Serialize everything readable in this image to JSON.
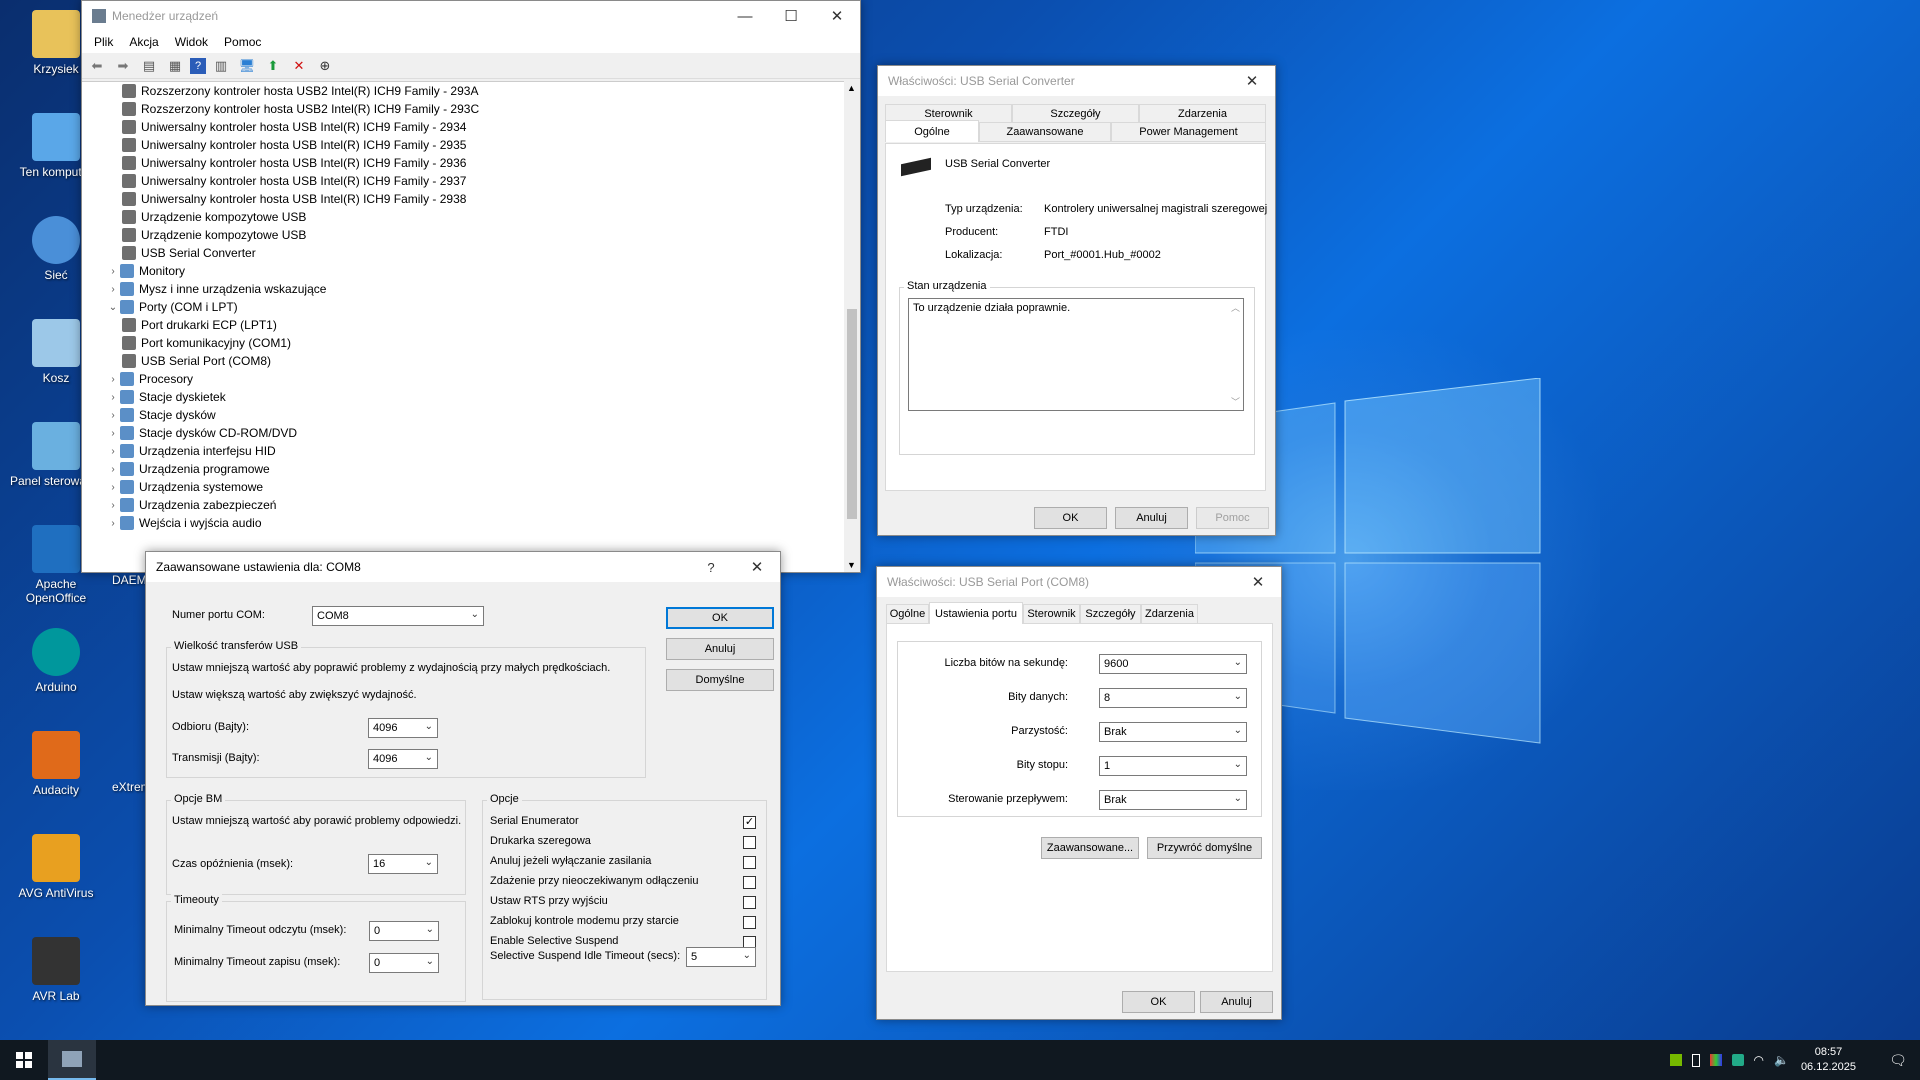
{
  "desktop": {
    "icons": [
      {
        "label": "Krzysiek",
        "icon": "user-folder-icon"
      },
      {
        "label": "Ten komputer",
        "icon": "computer-icon"
      },
      {
        "label": "Sieć",
        "icon": "network-icon"
      },
      {
        "label": "Kosz",
        "icon": "recycle-bin-icon"
      },
      {
        "label": "Panel sterowania",
        "icon": "control-panel-icon"
      },
      {
        "label": "Apache OpenOffice",
        "icon": "openoffice-icon"
      },
      {
        "label": "Arduino",
        "icon": "arduino-icon"
      },
      {
        "label": "Audacity",
        "icon": "audacity-icon"
      },
      {
        "label": "AVG AntiVirus",
        "icon": "avg-icon"
      },
      {
        "label": "AVR Lab",
        "icon": "avr-lab-icon"
      }
    ],
    "partial_labels": [
      "DAEM",
      "eXtrem"
    ]
  },
  "device_manager": {
    "title": "Menedżer urządzeń",
    "menu": [
      "Plik",
      "Akcja",
      "Widok",
      "Pomoc"
    ],
    "tree": [
      {
        "label": "Rozszerzony kontroler hosta USB2 Intel(R) ICH9 Family - 293A",
        "level": 2
      },
      {
        "label": "Rozszerzony kontroler hosta USB2 Intel(R) ICH9 Family - 293C",
        "level": 2
      },
      {
        "label": "Uniwersalny kontroler hosta USB Intel(R) ICH9 Family - 2934",
        "level": 2
      },
      {
        "label": "Uniwersalny kontroler hosta USB Intel(R) ICH9 Family - 2935",
        "level": 2
      },
      {
        "label": "Uniwersalny kontroler hosta USB Intel(R) ICH9 Family - 2936",
        "level": 2
      },
      {
        "label": "Uniwersalny kontroler hosta USB Intel(R) ICH9 Family - 2937",
        "level": 2
      },
      {
        "label": "Uniwersalny kontroler hosta USB Intel(R) ICH9 Family - 2938",
        "level": 2
      },
      {
        "label": "Urządzenie kompozytowe USB",
        "level": 2
      },
      {
        "label": "Urządzenie kompozytowe USB",
        "level": 2
      },
      {
        "label": "USB Serial Converter",
        "level": 2
      },
      {
        "label": "Monitory",
        "level": 1,
        "expander": "›"
      },
      {
        "label": "Mysz i inne urządzenia wskazujące",
        "level": 1,
        "expander": "›"
      },
      {
        "label": "Porty (COM i LPT)",
        "level": 1,
        "expander": "⌄"
      },
      {
        "label": "Port drukarki ECP (LPT1)",
        "level": 2
      },
      {
        "label": "Port komunikacyjny (COM1)",
        "level": 2
      },
      {
        "label": "USB Serial Port (COM8)",
        "level": 2
      },
      {
        "label": "Procesory",
        "level": 1,
        "expander": "›"
      },
      {
        "label": "Stacje dyskietek",
        "level": 1,
        "expander": "›"
      },
      {
        "label": "Stacje dysków",
        "level": 1,
        "expander": "›"
      },
      {
        "label": "Stacje dysków CD-ROM/DVD",
        "level": 1,
        "expander": "›"
      },
      {
        "label": "Urządzenia interfejsu HID",
        "level": 1,
        "expander": "›"
      },
      {
        "label": "Urządzenia programowe",
        "level": 1,
        "expander": "›"
      },
      {
        "label": "Urządzenia systemowe",
        "level": 1,
        "expander": "›"
      },
      {
        "label": "Urządzenia zabezpieczeń",
        "level": 1,
        "expander": "›"
      },
      {
        "label": "Wejścia i wyjścia audio",
        "level": 1,
        "expander": "›"
      }
    ]
  },
  "converter_props": {
    "title": "Właściwości: USB Serial Converter",
    "tabs_row1": [
      "Sterownik",
      "Szczegóły",
      "Zdarzenia"
    ],
    "tabs_row2": [
      "Ogólne",
      "Zaawansowane",
      "Power Management"
    ],
    "device_name": "USB Serial Converter",
    "type_label": "Typ urządzenia:",
    "type_value": "Kontrolery uniwersalnej magistrali szeregowej",
    "maker_label": "Producent:",
    "maker_value": "FTDI",
    "loc_label": "Lokalizacja:",
    "loc_value": "Port_#0001.Hub_#0002",
    "status_group": "Stan urządzenia",
    "status_text": "To urządzenie działa poprawnie.",
    "ok": "OK",
    "cancel": "Anuluj",
    "help": "Pomoc"
  },
  "port_props": {
    "title": "Właściwości: USB Serial Port (COM8)",
    "tabs": [
      "Ogólne",
      "Ustawienia portu",
      "Sterownik",
      "Szczegóły",
      "Zdarzenia"
    ],
    "bits_label": "Liczba bitów na sekundę:",
    "bits_value": "9600",
    "data_label": "Bity danych:",
    "data_value": "8",
    "parity_label": "Parzystość:",
    "parity_value": "Brak",
    "stop_label": "Bity stopu:",
    "stop_value": "1",
    "flow_label": "Sterowanie przepływem:",
    "flow_value": "Brak",
    "advanced": "Zaawansowane...",
    "restore": "Przywróć domyślne",
    "ok": "OK",
    "cancel": "Anuluj"
  },
  "advanced": {
    "title": "Zaawansowane ustawienia dla: COM8",
    "help_glyph": "?",
    "com_label": "Numer portu COM:",
    "com_value": "COM8",
    "usb_group": "Wielkość transferów USB",
    "usb_hint1": "Ustaw mniejszą wartość aby poprawić problemy z wydajnością przy małych prędkościach.",
    "usb_hint2": "Ustaw większą wartość aby zwiększyć wydajność.",
    "rx_label": "Odbioru (Bajty):",
    "rx_value": "4096",
    "tx_label": "Transmisji (Bajty):",
    "tx_value": "4096",
    "bm_group": "Opcje BM",
    "bm_hint": "Ustaw mniejszą wartość aby porawić problemy odpowiedzi.",
    "latency_label": "Czas opóźnienia (msek):",
    "latency_value": "16",
    "timeouts_group": "Timeouty",
    "read_timeout_label": "Minimalny Timeout odczytu (msek):",
    "read_timeout_value": "0",
    "write_timeout_label": "Minimalny Timeout zapisu (msek):",
    "write_timeout_value": "0",
    "options_group": "Opcje",
    "options": [
      {
        "label": "Serial Enumerator",
        "checked": true
      },
      {
        "label": "Drukarka szeregowa",
        "checked": false
      },
      {
        "label": "Anuluj jeżeli wyłączanie zasilania",
        "checked": false
      },
      {
        "label": "Zdażenie przy nieoczekiwanym odłączeniu",
        "checked": false
      },
      {
        "label": "Ustaw RTS przy wyjściu",
        "checked": false
      },
      {
        "label": "Zablokuj kontrole modemu przy starcie",
        "checked": false
      },
      {
        "label": "Enable Selective Suspend",
        "checked": false
      }
    ],
    "suspend_label": "Selective Suspend Idle Timeout (secs):",
    "suspend_value": "5",
    "ok": "OK",
    "cancel": "Anuluj",
    "defaults": "Domyślne"
  },
  "taskbar": {
    "time": "08:57",
    "date": "06.12.2025"
  }
}
